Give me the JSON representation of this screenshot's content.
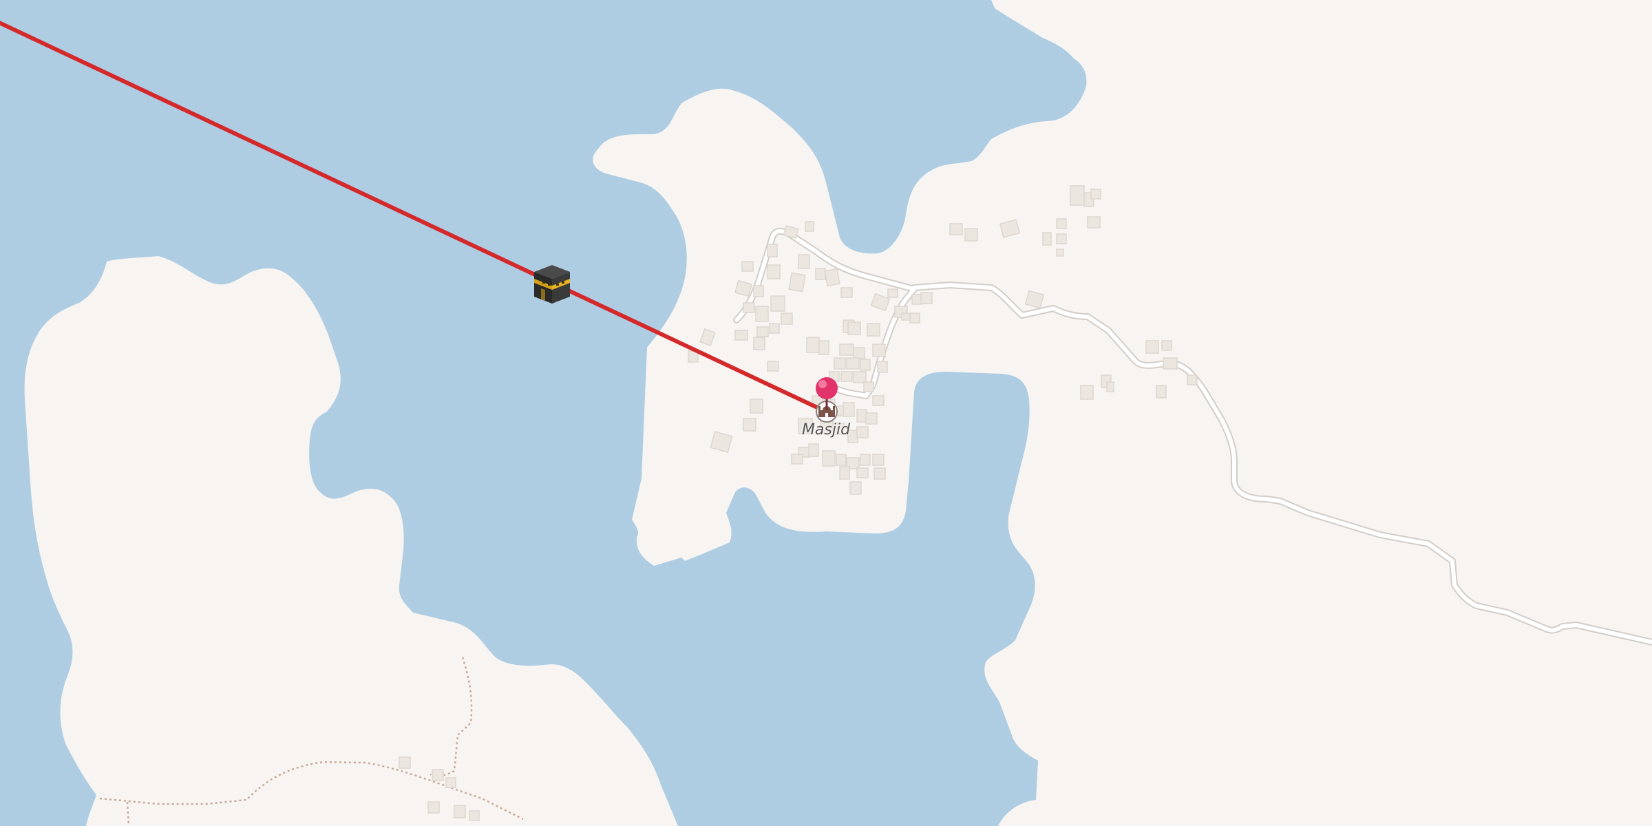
{
  "map": {
    "colors": {
      "water": "#aecde3",
      "land": "#f7f4f1",
      "road_casing": "#d2cdc8",
      "road_fill": "#ffffff",
      "building": "#ece6e1",
      "building_edge": "#ddd6d0",
      "path": "#c8a99a",
      "qibla_line": "#d4292b",
      "pin": "#e2336b"
    },
    "qibla": {
      "icon": "kaaba-icon"
    },
    "marker": {
      "icon": "map-pin-icon"
    },
    "poi": {
      "icon": "mosque-icon",
      "label": "Masjid"
    }
  }
}
